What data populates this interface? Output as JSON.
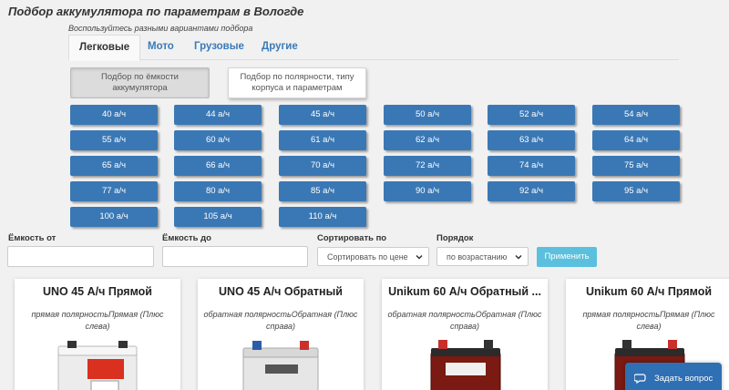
{
  "page": {
    "title": "Подбор аккумулятора по параметрам в Вологде",
    "subtitle": "Воспользуйтесь разными вариантами подбора"
  },
  "tabs": [
    {
      "label": "Легковые",
      "active": true
    },
    {
      "label": "Мото",
      "active": false
    },
    {
      "label": "Грузовые",
      "active": false
    },
    {
      "label": "Другие",
      "active": false
    }
  ],
  "modes": {
    "capacity": "Подбор по ёмкости аккумулятора",
    "polarity": "Подбор по полярности, типу корпуса и параметрам"
  },
  "capacities": [
    "40 а/ч",
    "44 а/ч",
    "45 а/ч",
    "50 а/ч",
    "52 а/ч",
    "54 а/ч",
    "55 а/ч",
    "60 а/ч",
    "61 а/ч",
    "62 а/ч",
    "63 а/ч",
    "64 а/ч",
    "65 а/ч",
    "66 а/ч",
    "70 а/ч",
    "72 а/ч",
    "74 а/ч",
    "75 а/ч",
    "77 а/ч",
    "80 а/ч",
    "85 а/ч",
    "90 а/ч",
    "92 а/ч",
    "95 а/ч",
    "100 а/ч",
    "105 а/ч",
    "110 а/ч"
  ],
  "filters": {
    "capacity_from_label": "Ёмкость от",
    "capacity_from_value": "",
    "capacity_to_label": "Ёмкость до",
    "capacity_to_value": "",
    "sort_label": "Сортировать по",
    "sort_value": "Сортировать по цене",
    "order_label": "Порядок",
    "order_value": "по возрастанию",
    "apply_label": "Применить"
  },
  "products": [
    {
      "title": "UNO 45 А/ч Прямой",
      "polarity": "прямая полярностьПрямая (Плюс слева)",
      "color": "#e8e8e8"
    },
    {
      "title": "UNO 45 А/ч Обратный",
      "polarity": "обратная полярностьОбратная (Плюс справа)",
      "color": "#e8e8e8"
    },
    {
      "title": "Unikum 60 А/ч Обратный ...",
      "polarity": "обратная полярностьОбратная (Плюс справа)",
      "color": "#7a1a12"
    },
    {
      "title": "Unikum 60 А/ч Прямой",
      "polarity": "прямая полярностьПрямая (Плюс слева)",
      "color": "#7a1a12"
    }
  ],
  "chat": {
    "label": "Задать вопрос"
  },
  "icons": {
    "chat": "chat-bubble-icon",
    "select": "chevron-down-icon"
  },
  "colors": {
    "primary": "#3a78b5",
    "link": "#3a7ab8",
    "apply": "#5bc0de",
    "chat": "#2f6fb3"
  }
}
